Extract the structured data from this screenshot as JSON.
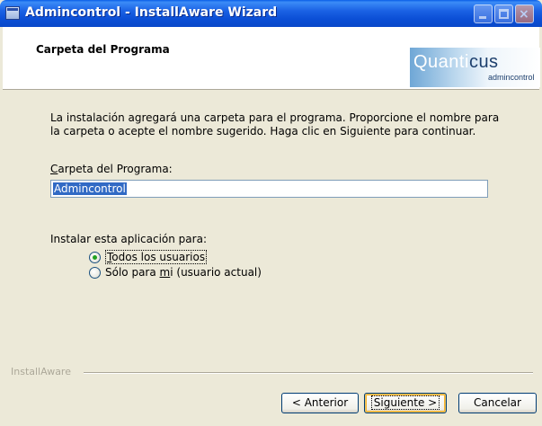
{
  "window": {
    "title": "Admincontrol - InstallAware Wizard",
    "controls": {
      "minimize": "_",
      "maximize": "□",
      "close": "×"
    }
  },
  "header": {
    "title": "Carpeta del Programa",
    "logo": {
      "main_light": "Quanti",
      "main_dark": "cus",
      "sub": "admincontrol"
    }
  },
  "content": {
    "description_line1": "La instalación agregará una carpeta para el programa. Proporcione el nombre para",
    "description_line2": "la carpeta o acepte el nombre sugerido. Haga clic en Siguiente para continuar.",
    "folder_label": "Carpeta del Programa:",
    "folder_value": "Admincontrol",
    "install_for_label": "Instalar esta aplicación para:",
    "options": [
      {
        "label": "Todos los usuarios",
        "selected": true
      },
      {
        "label": "Sólo para mi (usuario actual)",
        "selected": false
      }
    ]
  },
  "footer": {
    "brand": "InstallAware",
    "back_label": "< Anterior",
    "next_label": "Siguiente >",
    "cancel_label": "Cancelar"
  },
  "colors": {
    "titlebar": "#0a4fd6",
    "dialog_bg": "#ece9d8",
    "selection": "#316ac5",
    "radio_dot": "#21a121"
  }
}
